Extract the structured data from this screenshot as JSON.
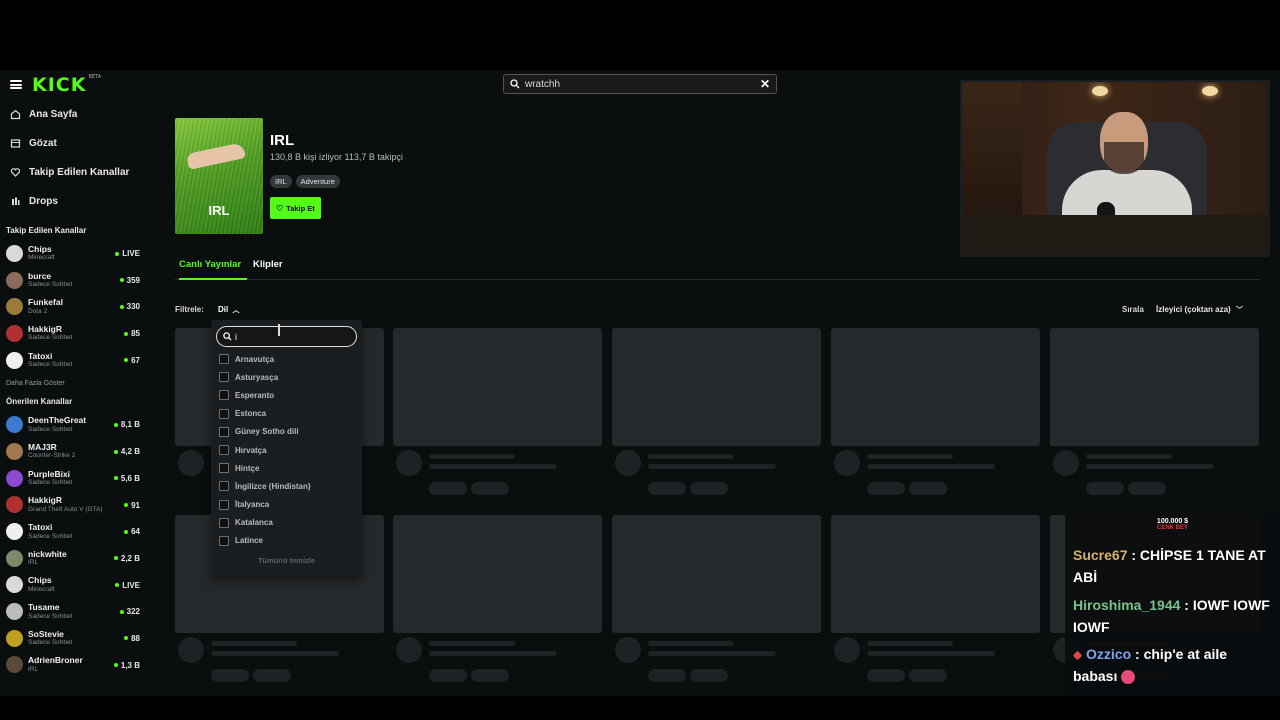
{
  "topbar": {
    "logo": "KICK",
    "logo_badge": "BETA",
    "search_value": "wratchh",
    "clear_label": "✕"
  },
  "sidebar": {
    "nav": [
      {
        "label": "Ana Sayfa",
        "icon": "home-icon"
      },
      {
        "label": "Gözat",
        "icon": "browse-icon"
      },
      {
        "label": "Takip Edilen Kanallar",
        "icon": "heart-icon"
      },
      {
        "label": "Drops",
        "icon": "drops-icon"
      }
    ],
    "followed_title": "Takip Edilen Kanallar",
    "followed": [
      {
        "name": "Chips",
        "sub": "Minecraft",
        "count": "LIVE",
        "color": "#d9d9d9"
      },
      {
        "name": "burce",
        "sub": "Sadece Sohbet",
        "count": "359",
        "color": "#8a6a5a"
      },
      {
        "name": "Funkefal",
        "sub": "Dota 2",
        "count": "330",
        "color": "#9c7a3a"
      },
      {
        "name": "HakkigR",
        "sub": "Sadece Sohbet",
        "count": "85",
        "color": "#b03030"
      },
      {
        "name": "Tatoxi",
        "sub": "Sadece Sohbet",
        "count": "67",
        "color": "#eeeeee"
      }
    ],
    "show_more": "Daha Fazla Göster",
    "recommended_title": "Önerilen Kanallar",
    "recommended": [
      {
        "name": "DeenTheGreat",
        "sub": "Sadece Sohbet",
        "count": "8,1 B",
        "color": "#3a7ad0"
      },
      {
        "name": "MAJ3R",
        "sub": "Counter-Strike 2",
        "count": "4,2 B",
        "color": "#a07850"
      },
      {
        "name": "PurpleBixi",
        "sub": "Sadece Sohbet",
        "count": "5,6 B",
        "color": "#8a4ad0"
      },
      {
        "name": "HakkigR",
        "sub": "Grand Theft Auto V (GTA)",
        "count": "91",
        "color": "#b03030"
      },
      {
        "name": "Tatoxi",
        "sub": "Sadece Sohbet",
        "count": "64",
        "color": "#eeeeee"
      },
      {
        "name": "nickwhite",
        "sub": "IRL",
        "count": "2,2 B",
        "color": "#7a8a6a"
      },
      {
        "name": "Chips",
        "sub": "Minecraft",
        "count": "LIVE",
        "color": "#d9d9d9"
      },
      {
        "name": "Tusame",
        "sub": "Sadece Sohbet",
        "count": "322",
        "color": "#bbbbbb"
      },
      {
        "name": "SoStevie",
        "sub": "Sadece Sohbet",
        "count": "88",
        "color": "#c0a020"
      },
      {
        "name": "AdrienBroner",
        "sub": "IRL",
        "count": "1,3 B",
        "color": "#5a4a3a"
      }
    ]
  },
  "category": {
    "image_label": "IRL",
    "title": "IRL",
    "stats": "130,8 B kişi izliyor  113,7 B takipçi",
    "tags": [
      "IRL",
      "Adventure"
    ],
    "follow_label": "Takip Et"
  },
  "tabs": [
    "Canlı Yayınlar",
    "Klipler"
  ],
  "filter": {
    "label": "Filtrele:",
    "language_button": "Dil",
    "sort_label": "Sırala",
    "sort_value": "İzleyici (çoktan aza)"
  },
  "dropdown": {
    "search_value": "i",
    "options": [
      "Arnavutça",
      "Asturyasça",
      "Esperanto",
      "Estonca",
      "Güney Sotho dili",
      "Hırvatça",
      "Hintçe",
      "İngilizce (Hindistan)",
      "İtalyanca",
      "Katalanca",
      "Latince"
    ],
    "clear_all": "Tümünü temizle"
  },
  "chat": {
    "donation_amount": "100.000 $",
    "donation_name": "CENK BEY",
    "messages": [
      {
        "user": "Sucre67",
        "text": ": CHİPSE 1 TANE AT ABİ"
      },
      {
        "user": "Hiroshima_1944",
        "text": ": IOWF IOWF IOWF"
      },
      {
        "user": "Ozzico",
        "text": ": chip'e at aile babası"
      }
    ]
  },
  "colors": {
    "accent": "#53fc18",
    "background": "#0b0e0f",
    "skeleton": "#26292b"
  }
}
